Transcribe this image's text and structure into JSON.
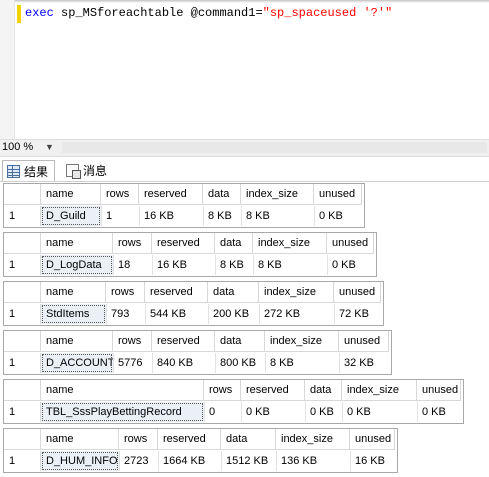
{
  "editor": {
    "kw1": "exec",
    "proc": "sp_MSforeachtable",
    "param": "@command1=",
    "arg": "\"sp_spaceused '?'\""
  },
  "zoom": {
    "value": "100 %"
  },
  "tabs": {
    "results": "结果",
    "messages": "消息"
  },
  "columns": {
    "name": "name",
    "rows": "rows",
    "reserved": "reserved",
    "data": "data",
    "index_size": "index_size",
    "unused": "unused"
  },
  "results": [
    {
      "row": "1",
      "name": "D_Guild",
      "rows": "1",
      "reserved": "16 KB",
      "data": "8 KB",
      "index_size": "8 KB",
      "unused": "0 KB"
    },
    {
      "row": "1",
      "name": "D_LogData",
      "rows": "18",
      "reserved": "16 KB",
      "data": "8 KB",
      "index_size": "8 KB",
      "unused": "0 KB"
    },
    {
      "row": "1",
      "name": "StdItems",
      "rows": "793",
      "reserved": "544 KB",
      "data": "200 KB",
      "index_size": "272 KB",
      "unused": "72 KB"
    },
    {
      "row": "1",
      "name": "D_ACCOUNT",
      "rows": "5776",
      "reserved": "840 KB",
      "data": "800 KB",
      "index_size": "8 KB",
      "unused": "32 KB"
    },
    {
      "row": "1",
      "name": "TBL_SssPlayBettingRecord",
      "rows": "0",
      "reserved": "0 KB",
      "data": "0 KB",
      "index_size": "0 KB",
      "unused": "0 KB"
    },
    {
      "row": "1",
      "name": "D_HUM_INFO",
      "rows": "2723",
      "reserved": "1664 KB",
      "data": "1512 KB",
      "index_size": "136 KB",
      "unused": "16 KB"
    }
  ]
}
